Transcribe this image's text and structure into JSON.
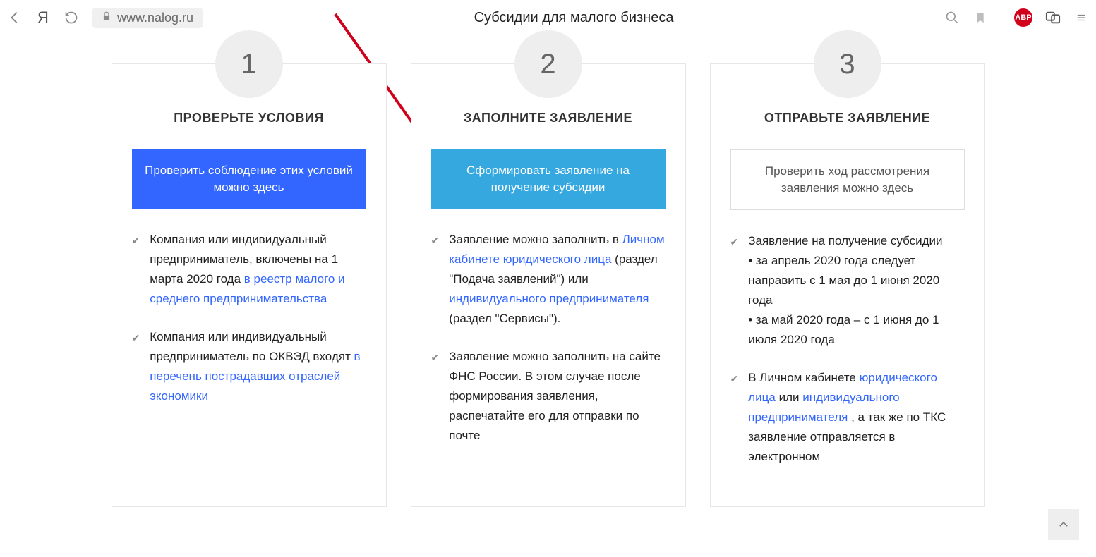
{
  "browser": {
    "url": "www.nalog.ru",
    "page_title": "Субсидии для малого бизнеса",
    "abp_label": "ABP"
  },
  "cards": [
    {
      "num": "1",
      "title": "ПРОВЕРЬТЕ УСЛОВИЯ",
      "button": "Проверить соблюдение этих условий можно здесь",
      "li1_a": "Компания или индивидуальный предприниматель, включены на 1 марта 2020 года ",
      "li1_link": "в реестр малого и среднего предпринимательства",
      "li2_a": "Компания или индивидуальный предприниматель по ОКВЭД входят ",
      "li2_link": "в перечень пострадавших отраслей экономики"
    },
    {
      "num": "2",
      "title": "ЗАПОЛНИТЕ ЗАЯВЛЕНИЕ",
      "button": "Сформировать заявление на получение субсидии",
      "li1_a": "Заявление можно заполнить в ",
      "li1_link1": "Личном кабинете юридического лица",
      "li1_b": " (раздел \"Подача заявлений\") или ",
      "li1_link2": "индивидуального предпринимателя",
      "li1_c": " (раздел \"Сервисы\").",
      "li2": "Заявление можно заполнить на сайте ФНС России. В этом случае после формирования заявления, распечатайте его для отправки по почте"
    },
    {
      "num": "3",
      "title": "ОТПРАВЬТЕ ЗАЯВЛЕНИЕ",
      "button": "Проверить ход рассмотрения заявления можно здесь",
      "li1": "Заявление на получение субсидии\n• за апрель 2020 года следует направить с 1 мая до 1 июня 2020 года\n• за май 2020 года – с 1 июня до 1 июля 2020 года",
      "li2_a": "В Личном кабинете ",
      "li2_link1": "юридического лица",
      "li2_b": " или ",
      "li2_link2": "индивидуального предпринимателя",
      "li2_c": ", а так же по ТКС заявление отправляется в электронном"
    }
  ]
}
